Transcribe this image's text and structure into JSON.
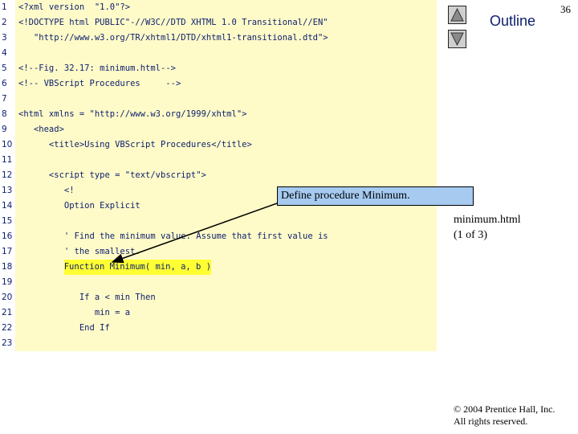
{
  "page_number": "36",
  "outline": {
    "title": "Outline",
    "up_icon": "triangle-up-icon",
    "down_icon": "triangle-down-icon"
  },
  "code": {
    "lines": [
      {
        "num": "1",
        "text": "<?xml version  \"1.0\"?>"
      },
      {
        "num": "2",
        "text": "<!DOCTYPE html PUBLIC\"-//W3C//DTD XHTML 1.0 Transitional//EN\""
      },
      {
        "num": "3",
        "text": "   \"http://www.w3.org/TR/xhtml1/DTD/xhtml1-transitional.dtd\">"
      },
      {
        "num": "4",
        "text": ""
      },
      {
        "num": "5",
        "text": "<!--Fig. 32.17: minimum.html-->"
      },
      {
        "num": "6",
        "text": "<!-- VBScript Procedures     -->"
      },
      {
        "num": "7",
        "text": ""
      },
      {
        "num": "8",
        "text": "<html xmlns = \"http://www.w3.org/1999/xhtml\">"
      },
      {
        "num": "9",
        "text": "   <head>"
      },
      {
        "num": "10",
        "text": "      <title>Using VBScript Procedures</title>"
      },
      {
        "num": "11",
        "text": ""
      },
      {
        "num": "12",
        "text": "      <script type = \"text/vbscript\">"
      },
      {
        "num": "13",
        "text": "         <!"
      },
      {
        "num": "14",
        "text": "         Option Explicit"
      },
      {
        "num": "15",
        "text": ""
      },
      {
        "num": "16",
        "text": "         ' Find the minimum value. Assume that first value is"
      },
      {
        "num": "17",
        "text": "         ' the smallest."
      },
      {
        "num": "18",
        "text": "         Function Minimum( min, a, b )"
      },
      {
        "num": "19",
        "text": ""
      },
      {
        "num": "20",
        "text": "            If a < min Then"
      },
      {
        "num": "21",
        "text": "               min = a"
      },
      {
        "num": "22",
        "text": "            End If"
      },
      {
        "num": "23",
        "text": ""
      }
    ]
  },
  "callout": {
    "text": "Define procedure Minimum."
  },
  "file_label": {
    "line1": "minimum.html",
    "line2": "(1 of 3)"
  },
  "copyright": {
    "line1": "© 2004 Prentice Hall, Inc.",
    "line2": "All rights reserved."
  },
  "colors": {
    "code_background": "#fffbc8",
    "code_text": "#0c1d6e",
    "highlight": "#ffff33",
    "callout_background": "#a6caf0"
  }
}
